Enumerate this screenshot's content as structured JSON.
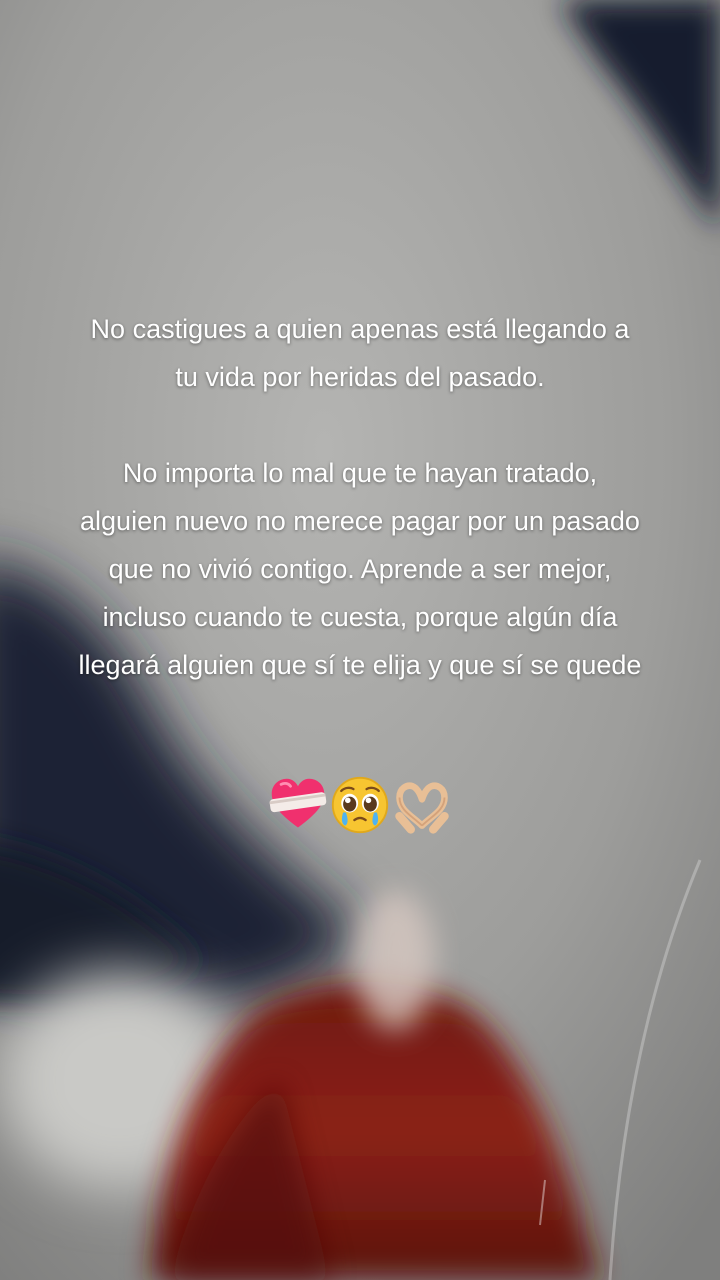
{
  "paragraphs": [
    {
      "lines": [
        "No castigues a quien apenas está llegando a",
        "tu vida por heridas del pasado."
      ]
    },
    {
      "lines": [
        "No importa lo mal que te hayan tratado,",
        "alguien nuevo no merece pagar por un pasado",
        "que no vivió contigo. Aprende a ser mejor,",
        "incluso cuando te cuesta, porque algún día",
        "llegará alguien que sí te elija y que sí se quede"
      ]
    }
  ],
  "emojis": [
    "mending-heart-icon",
    "pleading-face-icon",
    "heart-hands-icon"
  ],
  "colors": {
    "text": "#ffffff",
    "background_gray": "#9a9a98",
    "dark_shadow": "#1c2236",
    "red_fabric": "#7a1a12"
  }
}
